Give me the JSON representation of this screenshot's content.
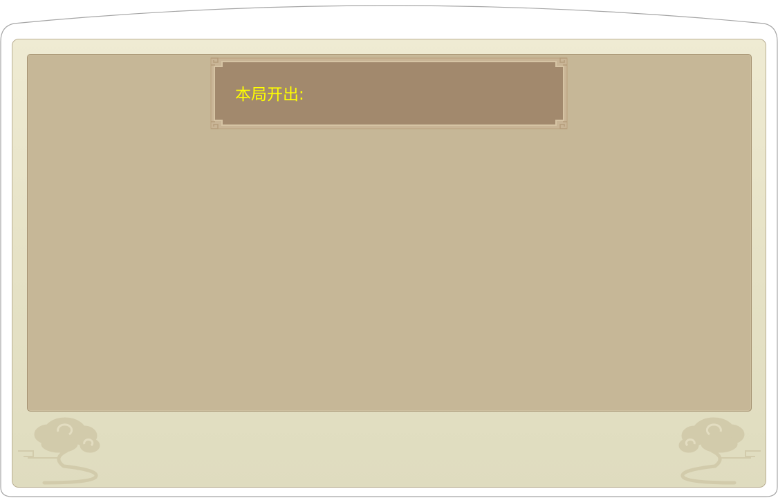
{
  "panel": {
    "title_label": "本局开出:"
  },
  "icons": {
    "left_ornament": "cloud-ornament-icon",
    "right_ornament": "cloud-ornament-icon"
  },
  "colors": {
    "panel_bg": "#c6b797",
    "plaque_bg": "#a2896d",
    "title_text": "#ffff00",
    "frame_bg": "#e6e2c6"
  }
}
